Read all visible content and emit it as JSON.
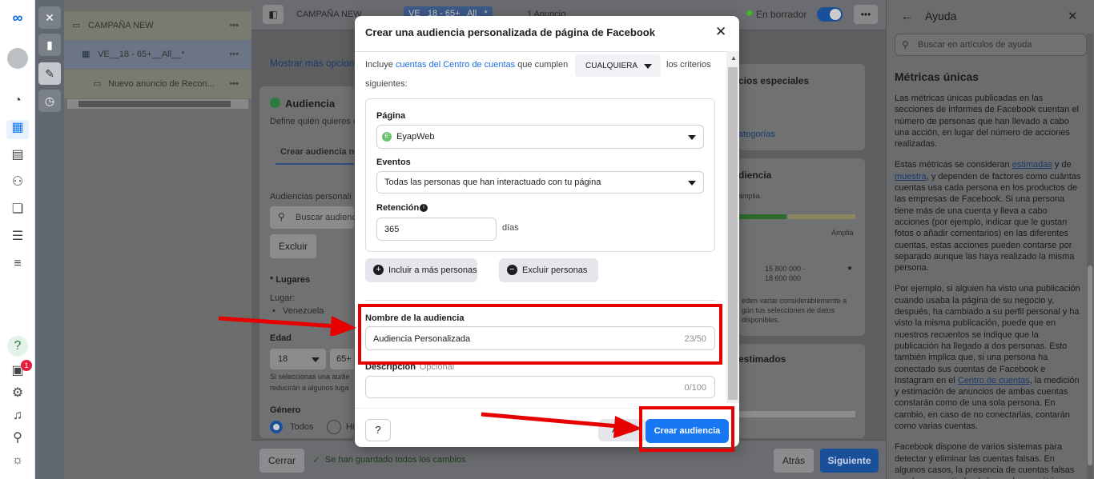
{
  "rail": {
    "icons": [
      "meta-logo-icon",
      "avatar-icon",
      "dashboard-icon",
      "ads-table-icon",
      "catalog-icon",
      "audiences-icon",
      "stack-icon",
      "database-icon",
      "menu-icon",
      "help-icon",
      "notifications-icon",
      "settings-icon",
      "bell-icon",
      "search-icon",
      "bug-icon"
    ],
    "notif_count": "1"
  },
  "tree": {
    "campaign": "CAMPAÑA NEW",
    "adset": "VE__18 - 65+__All__*",
    "ad": "Nuevo anuncio de Recon..."
  },
  "topbar": {
    "crumb1": "CAMPAÑA NEW",
    "crumb2": "VE_ 18 - 65+_ All_ *",
    "crumb3": "1 Anuncio",
    "status": "En borrador"
  },
  "main": {
    "more_options": "Mostrar más opcione",
    "audience_title": "Audiencia",
    "audience_desc": "Define quién quieres c",
    "tab_create": "Crear audiencia nu",
    "custom_audiences": "Audiencias personali",
    "search_placeholder": "Buscar audienc",
    "exclude": "Excluir",
    "places_title": "* Lugares",
    "place_label": "Lugar:",
    "place_value": "Venezuela",
    "age_title": "Edad",
    "age_min": "18",
    "age_max": "65+",
    "age_note": "Si seleccionas una audie reducirán a algunos luga",
    "gender_title": "Género",
    "gender_all": "Todos",
    "gender_other": "Ho",
    "special_categories": "cios especiales",
    "categories_link": "ategorías",
    "audience_def": "diencia",
    "broad_desc": "amplia.",
    "broad_label": "Amplia",
    "reach": "15 800 000 - 18 600 000",
    "reach_note": "eden variar considerablemente a gún tus selecciones de datos disponibles.",
    "estimated": "estimados",
    "cancel": "Cerrar",
    "saved": "Se han guardado todos los cambios",
    "back": "Atrás",
    "next": "Siguiente"
  },
  "help": {
    "title": "Ayuda",
    "search_placeholder": "Buscar en artículos de ayuda",
    "heading": "Métricas únicas",
    "p1": "Las métricas únicas publicadas en las secciones de informes de Facebook cuentan el número de personas que han llevado a cabo una acción, en lugar del número de acciones realizadas.",
    "p2a": "Estas métricas se consideran ",
    "p2_link1": "estimadas",
    "p2b": " y de ",
    "p2_link2": "muestra",
    "p2c": ", y dependen de factores como cuántas cuentas usa cada persona en los productos de las empresas de Facebook. Si una persona tiene más de una cuenta y lleva a cabo acciones (por ejemplo, indicar que le gustan fotos o añadir comentarios) en las diferentes cuentas, estas acciones pueden contarse por separado aunque las haya realizado la misma persona.",
    "p3a": "Por ejemplo, si alguien ha visto una publicación cuando usaba la página de su negocio y, después, ha cambiado a su perfil personal y ha visto la misma publicación, puede que en nuestros recuentos se indique que la publicación ha llegado a dos personas. Esto también implica que, si una persona ha conectado sus cuentas de Facebook e Instagram en el ",
    "p3_link": "Centro de cuentas",
    "p3b": ", la medición y estimación de anuncios de ambas cuentas constarán como de una sola persona. En cambio, en caso de no conectarlas, contarán como varias cuentas.",
    "p4": "Facebook dispone de varios sistemas para detectar y eliminar las cuentas falsas. En algunos casos, la presencia de cuentas falsas puede repercutir de algún modo en métricas"
  },
  "modal": {
    "title": "Crear una audiencia personalizada de página de Facebook",
    "include_prefix": "Incluye ",
    "include_link": "cuentas del Centro de cuentas",
    "include_mid": " que cumplen",
    "match_value": "CUALQUIERA",
    "include_suffix": "los criterios",
    "include_suffix2": "siguientes:",
    "page_label": "Página",
    "page_value": "EyapWeb",
    "events_label": "Eventos",
    "events_value": "Todas las personas que han interactuado con tu página",
    "retention_label": "Retención",
    "retention_value": "365",
    "retention_unit": "días",
    "include_more": "Incluir a más personas",
    "exclude_people": "Excluir personas",
    "name_label": "Nombre de la audiencia",
    "name_value": "Audiencia Personalizada",
    "name_count": "23/50",
    "desc_label": "Descripción",
    "desc_optional": "· Opcional",
    "desc_count": "0/100",
    "back": "Atrás",
    "create": "Crear audiencia"
  },
  "colors": {
    "primary": "#1877f2",
    "annotation": "#e60000",
    "success": "#42b72a"
  }
}
